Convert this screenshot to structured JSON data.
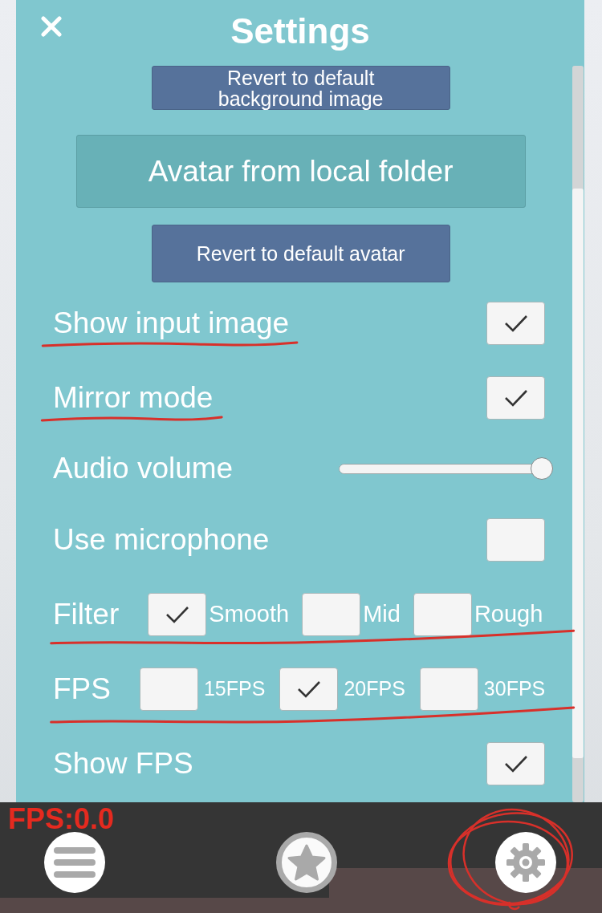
{
  "header": {
    "title": "Settings"
  },
  "items": [
    {
      "kind": "button",
      "label": "Revert to default background image",
      "underlined": false
    },
    {
      "kind": "widebutton",
      "label": "Avatar from local folder",
      "underlined": false
    },
    {
      "kind": "button",
      "label": "Revert to default avatar",
      "underlined": false
    },
    {
      "kind": "checkbox",
      "label": "Show input image",
      "checked": true,
      "underlined": true
    },
    {
      "kind": "checkbox",
      "label": "Mirror mode",
      "checked": true,
      "underlined": true
    },
    {
      "kind": "slider",
      "label": "Audio volume",
      "level": 1.0,
      "underlined": false
    },
    {
      "kind": "checkbox",
      "label": "Use microphone",
      "checked": false,
      "underlined": false
    },
    {
      "kind": "options",
      "label": "Filter",
      "underlined": true,
      "options": [
        {
          "label": "Smooth",
          "selected": true
        },
        {
          "label": "Mid",
          "selected": false
        },
        {
          "label": "Rough",
          "selected": false
        }
      ]
    },
    {
      "kind": "options",
      "label": "FPS",
      "underlined": true,
      "options": [
        {
          "label": "15FPS",
          "selected": false
        },
        {
          "label": "20FPS",
          "selected": true
        },
        {
          "label": "30FPS",
          "selected": false
        }
      ]
    },
    {
      "kind": "checkbox",
      "label": "Show FPS",
      "checked": true,
      "underlined": false
    }
  ],
  "status_bar": {
    "fps_readout": "FPS:0.0"
  },
  "nav_buttons": [
    {
      "kind": "menu",
      "circled": false
    },
    {
      "kind": "star",
      "circled": false
    },
    {
      "kind": "settings",
      "circled": true
    }
  ]
}
